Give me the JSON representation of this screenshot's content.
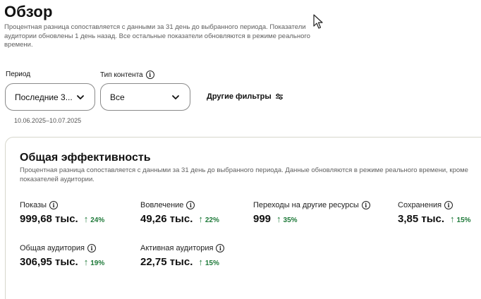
{
  "header": {
    "title": "Обзор",
    "description": "Процентная разница сопоставляется с данными за 31 день до выбранного периода. Показатели аудитории обновлены 1 день назад. Все остальные показатели обновляются в режиме реального времени."
  },
  "filters": {
    "period_label": "Период",
    "period_value": "Последние 3...",
    "content_type_label": "Тип контента",
    "content_type_value": "Все",
    "more_filters_label": "Другие фильтры",
    "date_range": "10.06.2025–10.07.2025"
  },
  "overall": {
    "title": "Общая эффективность",
    "description": "Процентная разница сопоставляется с данными за 31 день до выбранного периода. Данные обновляются в режиме реального времени, кроме показателей аудитории.",
    "metrics": [
      {
        "label": "Показы",
        "value": "999,68 тыс.",
        "change": "24%"
      },
      {
        "label": "Вовлечение",
        "value": "49,26 тыс.",
        "change": "22%"
      },
      {
        "label": "Переходы на другие ресурсы",
        "value": "999",
        "change": "35%"
      },
      {
        "label": "Сохранения",
        "value": "3,85 тыс.",
        "change": "15%"
      },
      {
        "label": "Общая аудитория",
        "value": "306,95 тыс.",
        "change": "19%"
      },
      {
        "label": "Активная аудитория",
        "value": "22,75 тыс.",
        "change": "15%"
      }
    ]
  },
  "icons": {
    "info": "info-icon",
    "chevron": "chevron-down-icon",
    "filters": "sliders-icon",
    "trend_up": "arrow-up-icon",
    "cursor": "mouse-cursor-icon"
  },
  "colors": {
    "positive_change": "#1f7a3a",
    "muted_text": "#5f5f5f",
    "border": "#8a8a8a"
  }
}
